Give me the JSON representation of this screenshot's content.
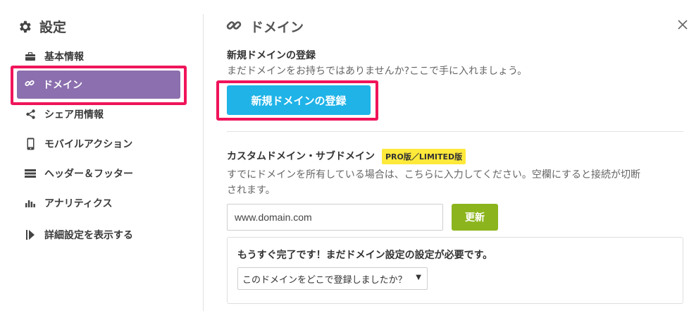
{
  "sidebar": {
    "title": "設定",
    "items": [
      {
        "label": "基本情報",
        "icon": "briefcase-icon"
      },
      {
        "label": "ドメイン",
        "icon": "link-icon",
        "active": true
      },
      {
        "label": "シェア用情報",
        "icon": "share-icon"
      },
      {
        "label": "モバイルアクション",
        "icon": "mobile-icon"
      },
      {
        "label": "ヘッダー＆フッター",
        "icon": "header-footer-icon"
      },
      {
        "label": "アナリティクス",
        "icon": "bar-chart-icon"
      },
      {
        "label": "詳細設定を表示する",
        "icon": "play-bar-icon"
      }
    ]
  },
  "panel": {
    "title": "ドメイン",
    "new_domain": {
      "label": "新規ドメインの登録",
      "desc": "まだドメインをお持ちではありませんか?ここで手に入れましょう。",
      "button": "新規ドメインの登録"
    },
    "custom_domain": {
      "label": "カスタムドメイン・サブドメイン",
      "badge": "PRO版／LIMITED版",
      "desc_line1": "すでにドメインを所有している場合は、こちらに入力してください。空欄にすると接続が切断",
      "desc_line2": "されます。",
      "input_value": "www.domain.com",
      "update_button": "更新"
    },
    "notice": {
      "title": "もうすぐ完了です！まだドメイン設定の設定が必要です。",
      "select_value": "このドメインをどこで登録しましたか？"
    }
  },
  "colors": {
    "active_nav": "#8b6fae",
    "highlight_outline": "#f0145a",
    "primary_button": "#1fb3e8",
    "update_button": "#8cb51d",
    "badge": "#ffe93b"
  }
}
